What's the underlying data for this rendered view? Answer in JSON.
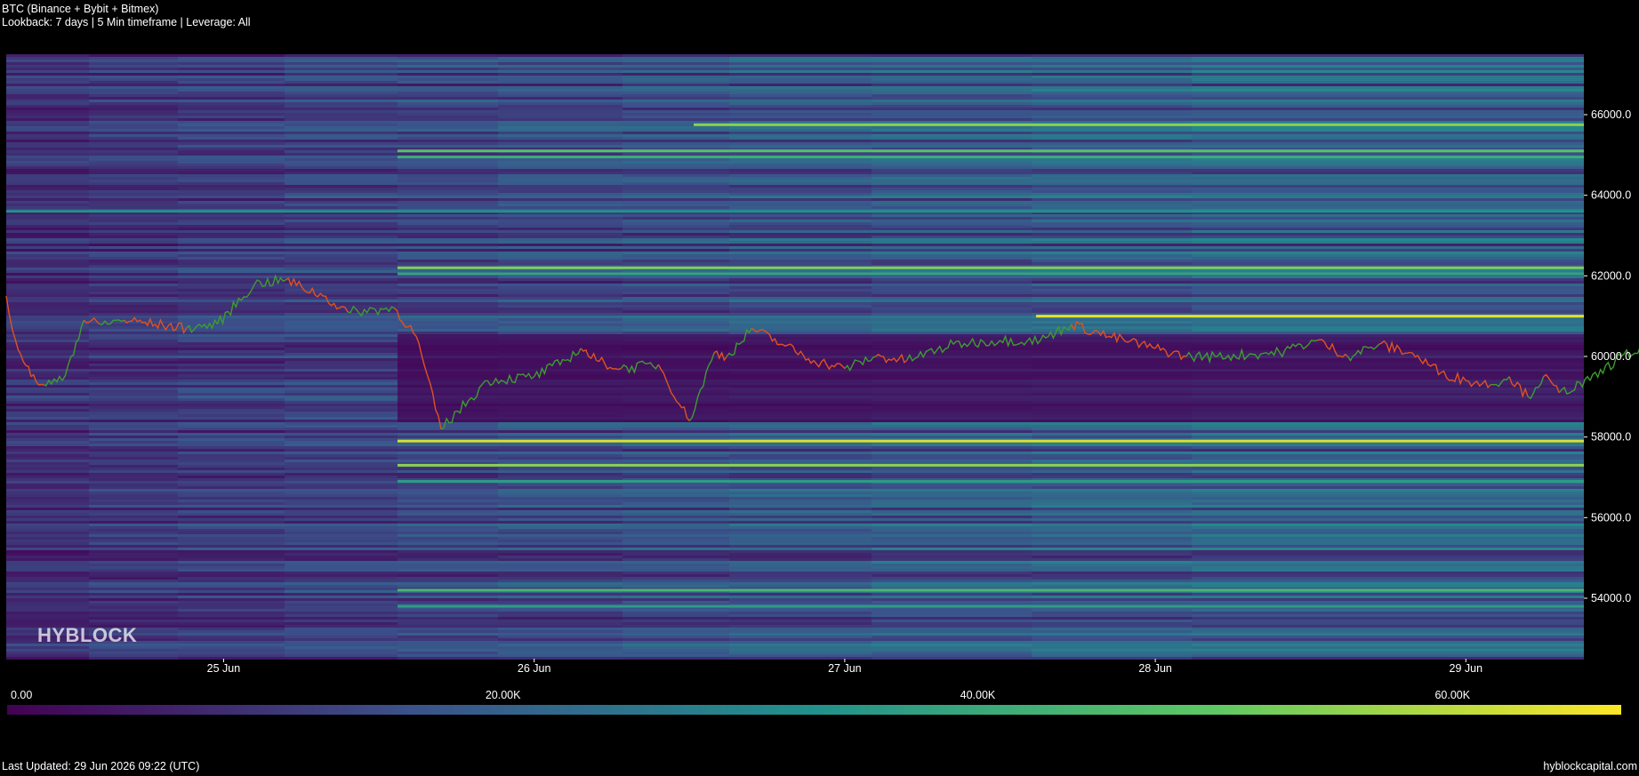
{
  "header": {
    "title": "BTC (Binance + Bybit + Bitmex)",
    "subtitle": "Lookback: 7 days | 5 Min timeframe | Leverage: All"
  },
  "watermark": "HYBLOCK",
  "footer": {
    "last_updated": "Last Updated: 29 Jun 2026 09:22 (UTC)",
    "site": "hyblockcapital.com"
  },
  "colors": {
    "background": "#000000",
    "colormap": [
      "#440154",
      "#3b528b",
      "#21918c",
      "#5ec962",
      "#fde725"
    ],
    "candle_up": "#3d9d2f",
    "candle_down": "#e0521f"
  },
  "chart_data": {
    "type": "heatmap",
    "y_scale": "linear",
    "ylim": [
      52500,
      67500
    ],
    "y_ticks": [
      54000,
      56000,
      58000,
      60000,
      62000,
      64000,
      66000
    ],
    "y_tick_labels": [
      "54000.0",
      "56000.0",
      "58000.0",
      "60000.0",
      "62000.0",
      "64000.0",
      "66000.0"
    ],
    "x_range": [
      "24 Jun",
      "29 Jun"
    ],
    "x_ticks": [
      "25 Jun",
      "26 Jun",
      "27 Jun",
      "28 Jun",
      "29 Jun"
    ],
    "colorbar": {
      "range": [
        0,
        68000
      ],
      "ticks": [
        0,
        20000,
        40000,
        60000
      ],
      "tick_labels": [
        "0.00",
        "20.00K",
        "40.00K",
        "60.00K"
      ]
    },
    "price_series": {
      "x_days": [
        24.0,
        24.1,
        24.14,
        24.18,
        24.21,
        24.23,
        24.28,
        24.33,
        24.38,
        24.42,
        24.48,
        24.5,
        24.55,
        24.6,
        24.68,
        24.78,
        24.88,
        24.98,
        25.1,
        25.2,
        25.32,
        25.4,
        25.55,
        25.62,
        25.7,
        25.85,
        26.0,
        26.1,
        26.15,
        26.2,
        26.28,
        26.4,
        26.5,
        26.58,
        26.62,
        26.66,
        26.7,
        26.8,
        26.9,
        27.0,
        27.1,
        27.2,
        27.35,
        27.5,
        27.63,
        27.68,
        27.73,
        27.85,
        28.0,
        28.1,
        28.2,
        28.4,
        28.52,
        28.62,
        28.72,
        28.82,
        28.92,
        29.0,
        29.08,
        29.14,
        29.2,
        29.25,
        29.3,
        29.4,
        29.5,
        29.58,
        29.6,
        29.7
      ],
      "prices": [
        62700,
        62800,
        62500,
        62400,
        63100,
        62700,
        61500,
        60400,
        59500,
        59300,
        59400,
        59800,
        60900,
        60800,
        60900,
        60800,
        60700,
        60800,
        61800,
        61900,
        61500,
        61100,
        61200,
        60500,
        58200,
        59400,
        59500,
        59900,
        60200,
        59900,
        59700,
        59800,
        58400,
        60100,
        60000,
        60300,
        60700,
        60300,
        59900,
        59700,
        60000,
        59900,
        60300,
        60400,
        60400,
        60600,
        60800,
        60500,
        60200,
        60000,
        60000,
        60100,
        60400,
        60000,
        60300,
        60100,
        59600,
        59400,
        59300,
        59500,
        59000,
        59500,
        59100,
        59400,
        60000,
        60200,
        59900,
        59900
      ],
      "min_price": 58100
    }
  }
}
